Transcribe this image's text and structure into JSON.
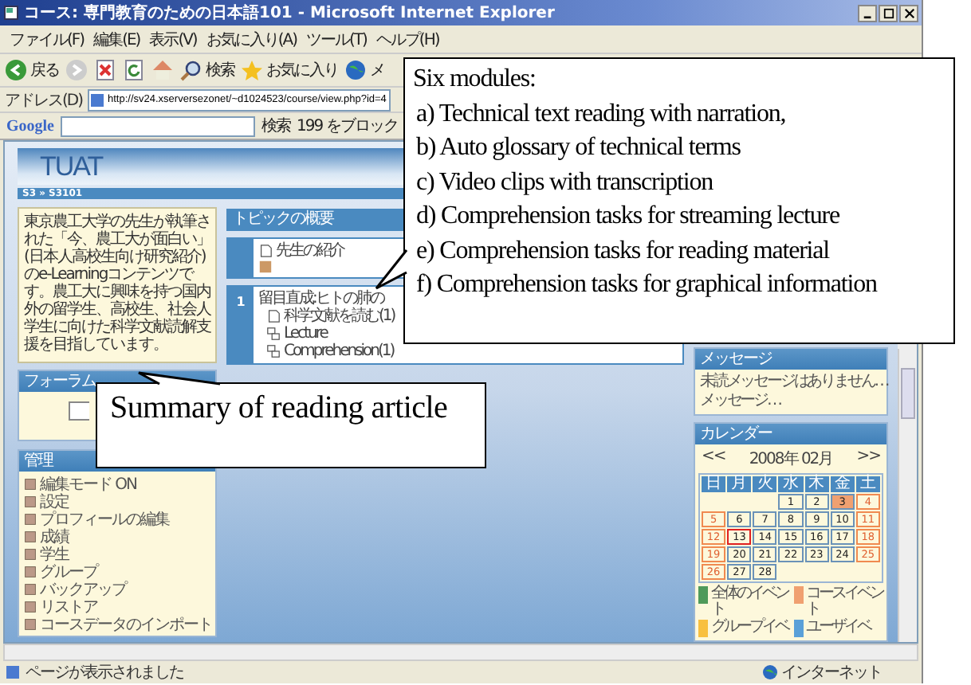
{
  "window": {
    "title": "コース: 専門教育のための日本語101 - Microsoft Internet Explorer"
  },
  "menu": [
    "ファイル(F)",
    "編集(E)",
    "表示(V)",
    "お気に入り(A)",
    "ツール(T)",
    "ヘルプ(H)"
  ],
  "toolbar": {
    "back": "戻る",
    "search": "検索",
    "favorites": "お気に入り",
    "media": "メ"
  },
  "address": {
    "label": "アドレス(D)",
    "url": "http://sv24.xserversezonet/~d1024523/course/view.php?id=4"
  },
  "google_bar": {
    "logo": "Google",
    "search": "検索",
    "blocked": "199 をブロック"
  },
  "site": {
    "logo": "TUAT",
    "breadcrumb": "S3 » S3101"
  },
  "summary": "東京農工大学の先生が執筆された「今、農工大が面白い」(日本人高校生向け研究紹介)のe-Learningコンテンツです。農工大に興味を持つ国内外の留学生、高校生、社会人学生に向けた科学文献読解支援を目指しています。",
  "forum": {
    "title": "フォーラム"
  },
  "admin": {
    "title": "管理",
    "items": [
      "編集モード ON",
      "設定",
      "プロフィールの編集",
      "成績",
      "学生",
      "グループ",
      "バックアップ",
      "リストア",
      "コースデータのインポート"
    ]
  },
  "topics": {
    "title": "トピックの概要",
    "intro": "先生の紹介",
    "sections": [
      {
        "number": "1",
        "title": "留目直成:ヒトの肺の",
        "items": [
          {
            "label": "科学文献を読む(1)",
            "kind": "document"
          },
          {
            "label": "Lecture",
            "kind": "module"
          },
          {
            "label": "Comprehension(1)",
            "kind": "module"
          }
        ]
      }
    ]
  },
  "messages": {
    "title": "メッセージ",
    "text": "未読メッセージはありません…",
    "link": "メッセージ…"
  },
  "calendar": {
    "title": "カレンダー",
    "prev": "<<",
    "month": "2008年 02月",
    "next": ">>",
    "weekdays": [
      "日",
      "月",
      "火",
      "水",
      "木",
      "金",
      "土"
    ],
    "weeks": [
      [
        {
          "kind": "blank"
        },
        {
          "kind": "blank"
        },
        {
          "kind": "blank"
        },
        {
          "day": "1",
          "kind": "weekday",
          "today": false,
          "event": false
        },
        {
          "day": "2",
          "kind": "weekday",
          "today": false,
          "event": false
        },
        {
          "day": "3",
          "kind": "weekday",
          "today": false,
          "event": true
        },
        {
          "day": "4",
          "kind": "weekend",
          "today": false,
          "event": false
        }
      ],
      [
        {
          "day": "5",
          "kind": "weekend",
          "today": false,
          "event": false
        },
        {
          "day": "6",
          "kind": "weekday",
          "today": false,
          "event": false
        },
        {
          "day": "7",
          "kind": "weekday",
          "today": false,
          "event": false
        },
        {
          "day": "8",
          "kind": "weekday",
          "today": false,
          "event": false
        },
        {
          "day": "9",
          "kind": "weekday",
          "today": false,
          "event": false
        },
        {
          "day": "10",
          "kind": "weekday",
          "today": false,
          "event": false
        },
        {
          "day": "11",
          "kind": "weekend",
          "today": false,
          "event": false
        }
      ],
      [
        {
          "day": "12",
          "kind": "weekend",
          "today": false,
          "event": false
        },
        {
          "day": "13",
          "kind": "weekday",
          "today": true,
          "event": false
        },
        {
          "day": "14",
          "kind": "weekday",
          "today": false,
          "event": false
        },
        {
          "day": "15",
          "kind": "weekday",
          "today": false,
          "event": false
        },
        {
          "day": "16",
          "kind": "weekday",
          "today": false,
          "event": false
        },
        {
          "day": "17",
          "kind": "weekday",
          "today": false,
          "event": false
        },
        {
          "day": "18",
          "kind": "weekend",
          "today": false,
          "event": false
        }
      ],
      [
        {
          "day": "19",
          "kind": "weekend",
          "today": false,
          "event": false
        },
        {
          "day": "20",
          "kind": "weekday",
          "today": false,
          "event": false
        },
        {
          "day": "21",
          "kind": "weekday",
          "today": false,
          "event": false
        },
        {
          "day": "22",
          "kind": "weekday",
          "today": false,
          "event": false
        },
        {
          "day": "23",
          "kind": "weekday",
          "today": false,
          "event": false
        },
        {
          "day": "24",
          "kind": "weekday",
          "today": false,
          "event": false
        },
        {
          "day": "25",
          "kind": "weekend",
          "today": false,
          "event": false
        }
      ],
      [
        {
          "day": "26",
          "kind": "weekend",
          "today": false,
          "event": false
        },
        {
          "day": "27",
          "kind": "weekday",
          "today": false,
          "event": false
        },
        {
          "day": "28",
          "kind": "weekday",
          "today": false,
          "event": false
        },
        {
          "kind": "blank"
        },
        {
          "kind": "blank"
        },
        {
          "kind": "blank"
        },
        {
          "kind": "blank"
        }
      ]
    ],
    "legend": [
      {
        "label": "全体のイベント",
        "color": "#4f9a5a"
      },
      {
        "label": "コースイベント",
        "color": "#f0a070"
      },
      {
        "label": "グループイベ",
        "color": "#f8c040"
      },
      {
        "label": "ユーザイベ",
        "color": "#5aa0d8"
      }
    ]
  },
  "status_bar": {
    "text": "ページが表示されました",
    "zone": "インターネット"
  },
  "callouts": [
    {
      "title": "Six modules:",
      "lines": [
        "a) Technical text reading with narration,",
        "b) Auto glossary of technical terms",
        "c) Video clips with transcription",
        "d) Comprehension tasks for streaming lecture",
        "e) Comprehension tasks for reading material",
        "f) Comprehension tasks for graphical information"
      ]
    },
    {
      "title": "Summary of reading article"
    }
  ]
}
